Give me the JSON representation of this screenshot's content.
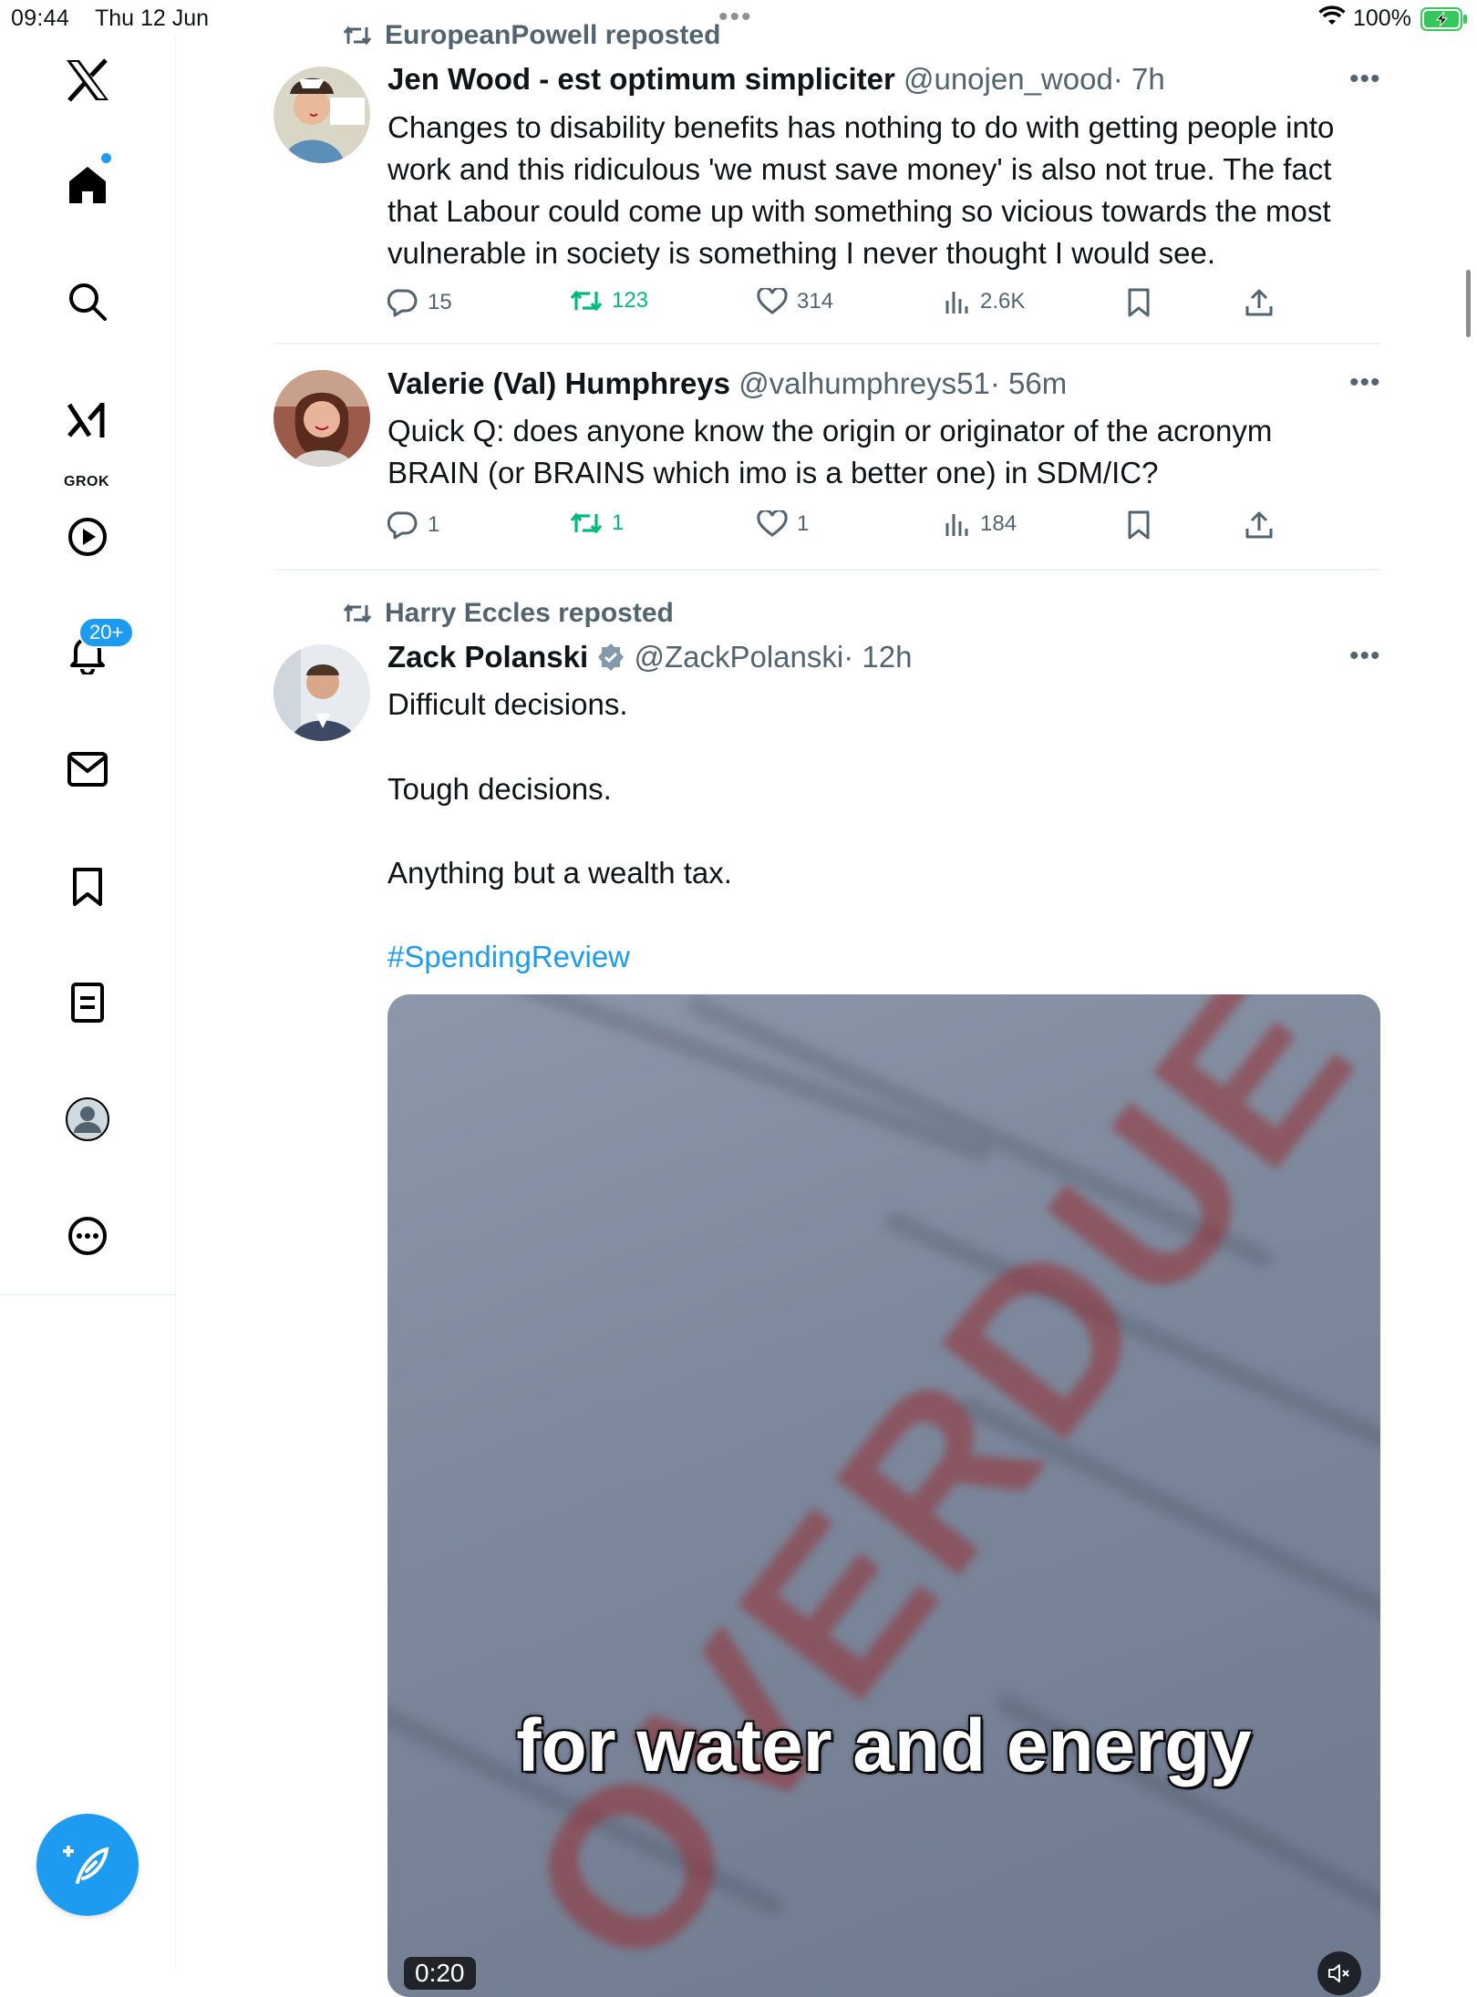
{
  "status_bar": {
    "time": "09:44",
    "date": "Thu 12 Jun",
    "battery": "100%"
  },
  "sidebar": {
    "notifications_badge": "20+",
    "grok_label": "GROK",
    "items": [
      "x-logo-icon",
      "home-icon",
      "search-icon",
      "grok-icon",
      "video-icon",
      "notifications-icon",
      "messages-icon",
      "bookmarks-icon",
      "lists-icon",
      "profile-icon",
      "more-icon"
    ]
  },
  "tweets": [
    {
      "repost_by": "EuropeanPowell reposted",
      "name": "Jen Wood - est optimum simpliciter",
      "handle": "@unojen_wood",
      "age": "· 7h",
      "text": "Changes to disability benefits has nothing to do with getting people into work and this ridiculous 'we must save money' is also not true. The fact that Labour could come up with something so vicious towards the most vulnerable in society is something I never thought I would see.",
      "replies": "15",
      "reposts": "123",
      "likes": "314",
      "views": "2.6K"
    },
    {
      "name": "Valerie (Val) Humphreys",
      "handle": "@valhumphreys51",
      "age": "· 56m",
      "text": "Quick Q: does anyone know the origin or originator of the acronym BRAIN (or BRAINS which imo is a better one) in SDM/IC?",
      "replies": "1",
      "reposts": "1",
      "likes": "1",
      "views": "184"
    },
    {
      "repost_by": "Harry Eccles reposted",
      "name": "Zack Polanski",
      "handle": "@ZackPolanski",
      "age": "· 12h",
      "line1": "Difficult decisions.",
      "line2": "Tough decisions.",
      "line3": "Anything but a wealth tax.",
      "hashtag": "#SpendingReview",
      "video": {
        "overlay_word": "OVERDUE",
        "caption": "for water and energy",
        "duration": "0:20"
      }
    }
  ],
  "colors": {
    "accent": "#1d9bf0",
    "repost_green": "#00ba7c",
    "secondary_text": "#536471"
  }
}
